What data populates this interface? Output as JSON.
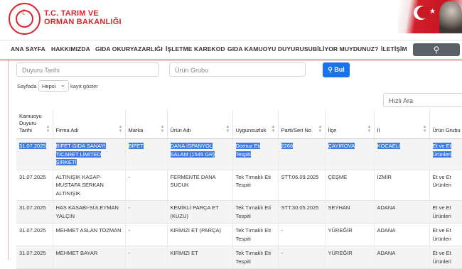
{
  "header": {
    "logo_line1": "T.C. TARIM VE",
    "logo_line2": "ORMAN BAKANLIĞI"
  },
  "nav": {
    "items": [
      "ANA SAYFA",
      "HAKKIMIZDA",
      "GIDA OKURYAZARLIĞI",
      "İŞLETME KAREKOD",
      "GIDA KAMUOYU DUYURUSU",
      "BİLİYOR MUYDUNUZ?",
      "İLETİŞİM"
    ],
    "search_icon": "search-icon"
  },
  "filters": {
    "date_placeholder": "Duyuru Tarihi",
    "group_placeholder": "Ürün Grubu",
    "search_label": "Bul",
    "page_size_prefix": "Sayfada",
    "page_size_value": "Hepsi",
    "page_size_suffix": "kayıt göster",
    "quick_search_placeholder": "Hızlı Ara"
  },
  "table": {
    "headers": [
      "Kamuoyu Duyuru Tarihi",
      "Firma Adı",
      "Marka",
      "Ürün Adı",
      "Uygunsuzluk",
      "Parti/Seri No",
      "İlçe",
      "İl",
      "Ürün Grubu"
    ],
    "rows": [
      [
        "31.07.2025",
        "BİFET GIDA SANAYİ TİCARET LİMİTED ŞİRKETİ",
        "BİFET",
        "DANA İSPANYOL SALAM (1545 GR)",
        "Domuz Eti Tespiti",
        "2266",
        "ÇAYIROVA",
        "KOCAELİ",
        "Et ve Et Ürünleri"
      ],
      [
        "31.07.2025",
        "ALTINIŞIK KASAP-MUSTAFA SERKAN ALTINIŞIK",
        "-",
        "FERMENTE DANA SUCUK",
        "Tek Tırnaklı Eti Tespiti",
        "STT:06.09.2025",
        "ÇEŞME",
        "İZMİR",
        "Et ve Et Ürünleri"
      ],
      [
        "31.07.2025",
        "HAS KASABI-SÜLEYMAN YALÇIN",
        "-",
        "KEMİKLİ PARÇA ET (KUZU)",
        "Tek Tırnaklı Eti Tespiti",
        "STT:30.05.2025",
        "SEYHAN",
        "ADANA",
        "Et ve Et Ürünleri"
      ],
      [
        "31.07.2025",
        "MEHMET ASLAN TOZMAN",
        "-",
        "KIRMIZI ET (PARÇA)",
        "Tek Tırnaklı Eti Tespiti",
        "-",
        "YÜREĞİR",
        "ADANA",
        "Et ve Et Ürünleri"
      ],
      [
        "31.07.2025",
        "MEHMET BAYAR",
        "-",
        "KIRMIZI ET",
        "Tek Tırnaklı Eti Tespiti",
        "-",
        "YÜREĞİR",
        "ADANA",
        "Et ve Et Ürünleri"
      ]
    ]
  },
  "colors": {
    "brand_red": "#d7262f",
    "primary_blue": "#1a73e8",
    "selection": "#3d7be6"
  }
}
